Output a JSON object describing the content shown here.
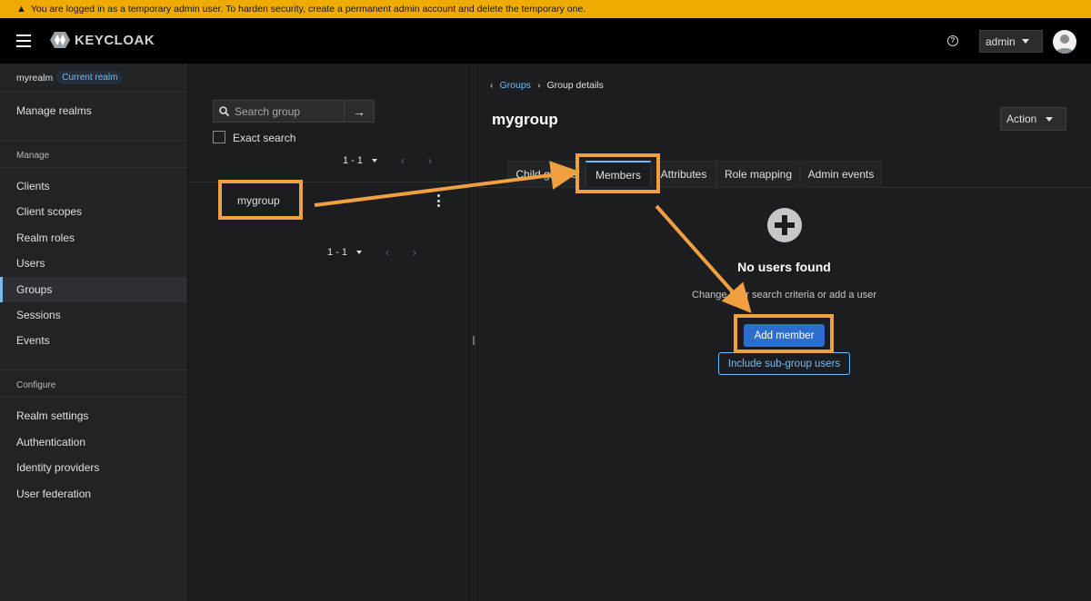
{
  "banner": {
    "text": "You are logged in as a temporary admin user. To harden security, create a permanent admin account and delete the temporary one."
  },
  "header": {
    "logo_text": "KEYCLOAK",
    "user": "admin"
  },
  "sidebar": {
    "realm": "myrealm",
    "realm_badge": "Current realm",
    "manage_realms": "Manage realms",
    "manage_heading": "Manage",
    "manage_items": [
      "Clients",
      "Client scopes",
      "Realm roles",
      "Users",
      "Groups",
      "Sessions",
      "Events"
    ],
    "configure_heading": "Configure",
    "configure_items": [
      "Realm settings",
      "Authentication",
      "Identity providers",
      "User federation"
    ]
  },
  "groups_panel": {
    "search_placeholder": "Search group",
    "exact_search": "Exact search",
    "pager_top": "1 - 1",
    "pager_bottom": "1 - 1",
    "groups": [
      "mygroup"
    ]
  },
  "detail": {
    "breadcrumb_link": "Groups",
    "breadcrumb_current": "Group details",
    "title": "mygroup",
    "action": "Action",
    "tabs": [
      "Child groups",
      "Members",
      "Attributes",
      "Role mapping",
      "Admin events"
    ],
    "active_tab": "Members",
    "empty_title": "No users found",
    "empty_body": "Change your search criteria or add a user",
    "add_member": "Add member",
    "include_subgroup": "Include sub-group users"
  },
  "colors": {
    "banner": "#f0ab00",
    "accent": "#73bcf7",
    "primary_button": "#2b6ecd",
    "highlight": "#f0a040"
  }
}
